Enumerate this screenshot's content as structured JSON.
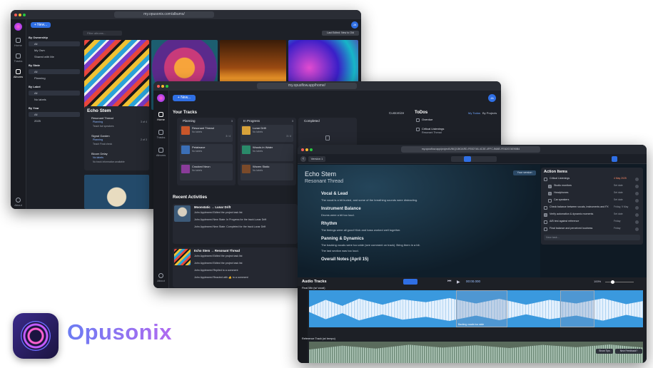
{
  "w1": {
    "url": "my.opusonix.com/albums/",
    "new_label": "+ New...",
    "search_placeholder": "Filter albums...",
    "sort_label": "Last Edited: New to Old",
    "nav": {
      "home": "Home",
      "tracks": "Tracks",
      "albums": "Albums",
      "about": "About"
    },
    "filters": [
      {
        "heading": "By Ownership",
        "items": [
          "All",
          "My Own",
          "Shared with Me"
        ]
      },
      {
        "heading": "By State",
        "items": [
          "All",
          "Planning"
        ]
      },
      {
        "heading": "By Label",
        "items": [
          "All",
          "No labels"
        ]
      },
      {
        "heading": "By Year",
        "items": [
          "All",
          "2025"
        ]
      }
    ],
    "album_title": "Echo Stem",
    "album_tracks": [
      {
        "name": "Resonant Thread",
        "sub": "Planning",
        "note": "Teach fair speakers",
        "count": "3 of 4"
      },
      {
        "name": "Signal Garden",
        "sub": "Planning",
        "note": "Teach Final check",
        "count": "2 of 3"
      },
      {
        "name": "Bloom Delay",
        "sub": "No labels",
        "note": "No track information available",
        "count": ""
      }
    ],
    "avatar": "JA"
  },
  "w2": {
    "url": "my.opusflow.app/home/",
    "new_label": "+ New...",
    "avatar": "JA",
    "nav": {
      "home": "Home",
      "tracks": "Tracks",
      "albums": "Albums",
      "about": "About"
    },
    "your_tracks": "Your Tracks",
    "customize": "Customize",
    "columns": [
      {
        "title": "Planning",
        "count": "3"
      },
      {
        "title": "In Progress",
        "count": "3"
      },
      {
        "title": "Completed",
        "count": ""
      }
    ],
    "cards": [
      {
        "col": 0,
        "title": "Resonant Thread",
        "label": "No labels",
        "frac": "3 / 4"
      },
      {
        "col": 0,
        "title": "Petalwave",
        "label": "No labels",
        "frac": ""
      },
      {
        "col": 0,
        "title": "Cracked Neon",
        "label": "No labels",
        "frac": ""
      },
      {
        "col": 1,
        "title": "Lunar Drift",
        "label": "No labels",
        "frac": "3 / 4"
      },
      {
        "col": 1,
        "title": "Woods in Water",
        "label": "No labels",
        "frac": ""
      },
      {
        "col": 1,
        "title": "Woven Static",
        "label": "No labels",
        "frac": ""
      }
    ],
    "todos": "ToDos",
    "todo_tabs": [
      "My Todos",
      "By Projects"
    ],
    "todo_items": [
      {
        "title": "Overdue",
        "sub": ""
      },
      {
        "title": "Critical Listenings",
        "sub": "Resonant Thread"
      }
    ],
    "recent": "Recent Activities",
    "activities": [
      {
        "title": "Moonstatic → Lunar Drift",
        "lines": [
          "John Appleseed Edited the project task list",
          "John Appleseed New State: In Progress for the track Lunar Drift",
          "John Appleseed New State: Completed for the track Lunar Drift"
        ]
      },
      {
        "title": "Echo Stem → Resonant Thread",
        "lines": [
          "John Appleseed Edited the project task list",
          "John Appleseed Edited the project task list",
          "John Appleseed Replied to a comment",
          "John Appleseed Reacted with 👍 to a comment"
        ]
      }
    ]
  },
  "w3": {
    "url": "my.opusflow.app/project/UNIQ/1BOARD-FE82748-4C3E-4FFC-B68E-FE82G74E90B4",
    "version": "Version 1",
    "title": "Echo Stem",
    "subtitle": "Resonant Thread",
    "your_version": "Your version",
    "notes": [
      {
        "heading": "Vocal & Lead",
        "lines": [
          "The vocal is a bit buried, and some of the breathing sounds were distracting."
        ]
      },
      {
        "heading": "Instrument Balance",
        "lines": [
          "Drums were a bit too loud."
        ]
      },
      {
        "heading": "Rhythm",
        "lines": [
          "The timings were all good! Kick and bass worked well together."
        ]
      },
      {
        "heading": "Panning & Dynamics",
        "lines": [
          "The backing vocals were too wide (see comment on track). Bring them in a bit.",
          "The last section was too loud."
        ]
      },
      {
        "heading": "Overall Notes (April 15)",
        "lines": []
      }
    ],
    "action_items": "Action Items",
    "actions": [
      {
        "label": "Critical Listenings",
        "due": "4 May 2025",
        "checked": false
      },
      {
        "label": "Studio monitors",
        "due": "Set date",
        "checked": true
      },
      {
        "label": "Headphones",
        "due": "Set date",
        "checked": true
      },
      {
        "label": "Car speakers",
        "due": "Set date",
        "checked": false
      },
      {
        "label": "Check balance between vocals, instruments and FX",
        "due": "Friday, 9 May",
        "checked": false
      },
      {
        "label": "Verify automation & dynamic moments",
        "due": "Set date",
        "checked": true
      },
      {
        "label": "A/B test against reference",
        "due": "Friday",
        "checked": false
      },
      {
        "label": "Final balance and perceived loudness",
        "due": "Friday",
        "checked": false
      }
    ],
    "new_task": "New task...",
    "audio_tracks": "Audio Tracks",
    "time": "00:00.000",
    "zoom": "100%",
    "track1": "Final Mix (w/ vocal)",
    "region_label": "Backing vocals too wide",
    "track2": "Reference Track (w/ tempo)",
    "show_tips": "Show Tips",
    "new_feedback": "New Feedback?"
  },
  "brand": {
    "name": "Opusonix"
  }
}
